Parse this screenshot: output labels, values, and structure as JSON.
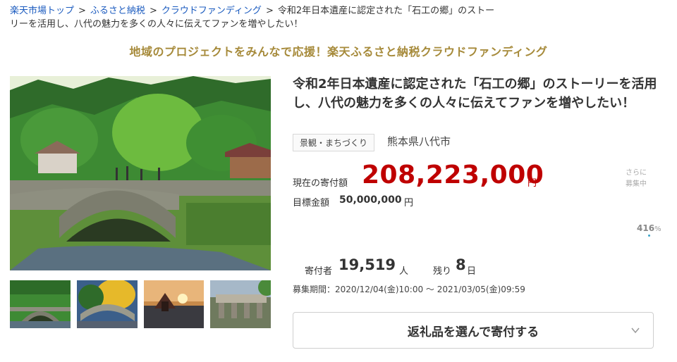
{
  "breadcrumb": {
    "items": [
      "楽天市場トップ",
      "ふるさと納税",
      "クラウドファンディング"
    ],
    "separator": ">",
    "current": "令和2年日本遺産に認定された「石工の郷」のストーリーを活用し、八代の魅力を多くの人々に伝えてファンを増やしたい！"
  },
  "banner": "地域のプロジェクトをみんなで応援！楽天ふるさと納税クラウドファンディング",
  "project": {
    "title": "令和2年日本遺産に認定された「石工の郷」のストーリーを活用し、八代の魅力を多くの人々に伝えてファンを増やしたい！",
    "tag": "景観・まちづくり",
    "location": "熊本県八代市"
  },
  "funding": {
    "current_label": "現在の寄付額",
    "current_amount": "208,223,000",
    "current_unit": "円",
    "target_label": "目標金額",
    "target_amount": "50,000,000",
    "target_unit": "円",
    "more_line1": "さらに",
    "more_line2": "募集中",
    "percent": "416",
    "percent_unit": "%",
    "donors_label": "寄付者",
    "donors_value": "19,519",
    "donors_unit": "人",
    "remain_label": "残り",
    "remain_value": "8",
    "remain_unit": "日",
    "period": "募集期間：2020/12/04(金)10:00 ～ 2021/03/05(金)09:59"
  },
  "cta": {
    "label": "返礼品を選んで寄付する",
    "icon": "chevron-down-icon"
  },
  "colors": {
    "link": "#1b5bbf",
    "banner": "#a68a3a",
    "amount": "#bf0000",
    "accent": "#3aa3c8"
  }
}
